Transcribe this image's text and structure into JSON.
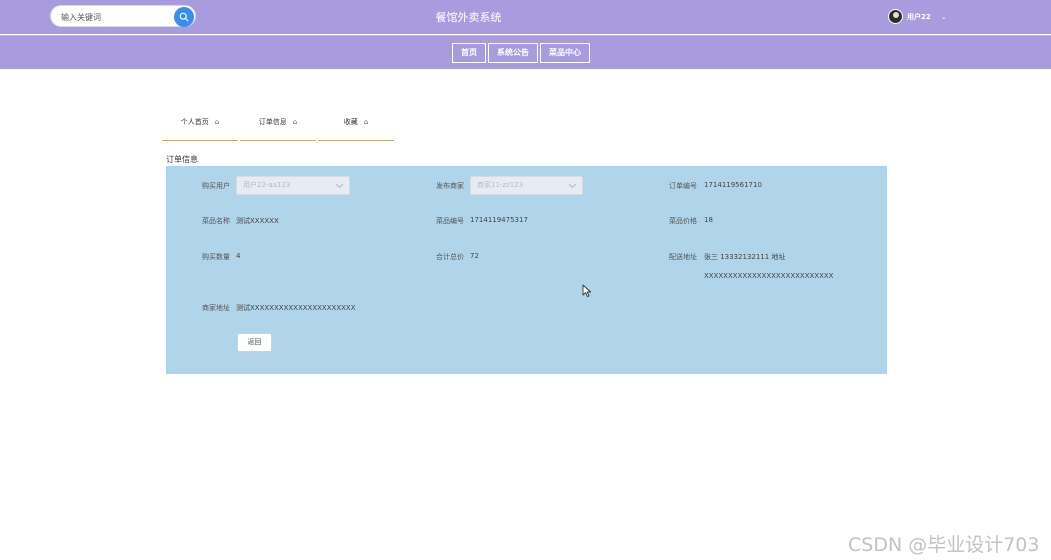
{
  "header": {
    "search_placeholder": "输入关键词",
    "site_title": "餐馆外卖系统",
    "user_name": "用户22",
    "user_caret": "⌄"
  },
  "nav": {
    "items": [
      "首页",
      "系统公告",
      "菜品中心"
    ]
  },
  "tabs": [
    {
      "label": "个人首页",
      "icon": "home-icon"
    },
    {
      "label": "订单信息",
      "icon": "home-icon"
    },
    {
      "label": "收藏",
      "icon": "home-icon"
    }
  ],
  "order": {
    "section_title": "订单信息",
    "buyer_label": "购买用户",
    "buyer_value": "用户22-aa123",
    "merchant_label": "发布商家",
    "merchant_value": "商家11-zz123",
    "order_no_label": "订单编号",
    "order_no_value": "1714119561710",
    "dish_name_label": "菜品名称",
    "dish_name_value": "测试XXXXXX",
    "dish_no_label": "菜品编号",
    "dish_no_value": "1714119475317",
    "price_label": "菜品价格",
    "price_value": "18",
    "qty_label": "购买数量",
    "qty_value": "4",
    "total_label": "合计总价",
    "total_value": "72",
    "address_label": "配送地址",
    "address_line1": "张三 13332132111 地址",
    "address_line2": "XXXXXXXXXXXXXXXXXXXXXXXXXXX",
    "merchant_addr_label": "商家地址",
    "merchant_addr_value": "测试XXXXXXXXXXXXXXXXXXXXXX",
    "back_button": "返回"
  },
  "watermark": "CSDN @毕业设计703",
  "colors": {
    "header_bg": "#a89bde",
    "panel_bg": "#b0d4ea",
    "search_button": "#3b8ef0",
    "tab_underline": "#d4a86a"
  }
}
